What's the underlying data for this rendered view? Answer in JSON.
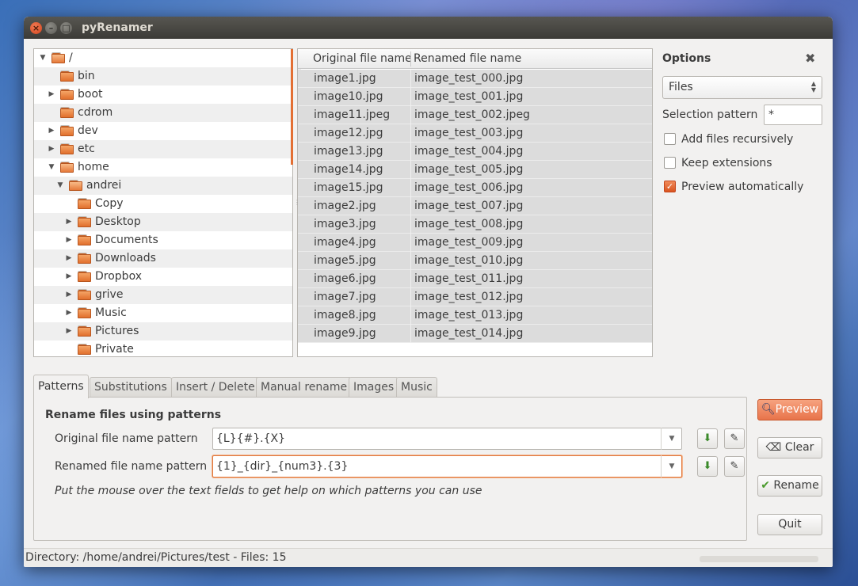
{
  "window": {
    "title": "pyRenamer"
  },
  "tree": {
    "items": [
      {
        "label": "/",
        "depth": 0,
        "expander": "open"
      },
      {
        "label": "bin",
        "depth": 1,
        "expander": "none"
      },
      {
        "label": "boot",
        "depth": 1,
        "expander": "closed"
      },
      {
        "label": "cdrom",
        "depth": 1,
        "expander": "none"
      },
      {
        "label": "dev",
        "depth": 1,
        "expander": "closed"
      },
      {
        "label": "etc",
        "depth": 1,
        "expander": "closed"
      },
      {
        "label": "home",
        "depth": 1,
        "expander": "open"
      },
      {
        "label": "andrei",
        "depth": 2,
        "expander": "open"
      },
      {
        "label": "Copy",
        "depth": 3,
        "expander": "none"
      },
      {
        "label": "Desktop",
        "depth": 3,
        "expander": "closed"
      },
      {
        "label": "Documents",
        "depth": 3,
        "expander": "closed"
      },
      {
        "label": "Downloads",
        "depth": 3,
        "expander": "closed"
      },
      {
        "label": "Dropbox",
        "depth": 3,
        "expander": "closed"
      },
      {
        "label": "grive",
        "depth": 3,
        "expander": "closed"
      },
      {
        "label": "Music",
        "depth": 3,
        "expander": "closed"
      },
      {
        "label": "Pictures",
        "depth": 3,
        "expander": "closed"
      },
      {
        "label": "Private",
        "depth": 3,
        "expander": "none"
      }
    ]
  },
  "filelist": {
    "columns": [
      "Original file name",
      "Renamed file name"
    ],
    "rows": [
      [
        "image1.jpg",
        "image_test_000.jpg"
      ],
      [
        "image10.jpg",
        "image_test_001.jpg"
      ],
      [
        "image11.jpeg",
        "image_test_002.jpeg"
      ],
      [
        "image12.jpg",
        "image_test_003.jpg"
      ],
      [
        "image13.jpg",
        "image_test_004.jpg"
      ],
      [
        "image14.jpg",
        "image_test_005.jpg"
      ],
      [
        "image15.jpg",
        "image_test_006.jpg"
      ],
      [
        "image2.jpg",
        "image_test_007.jpg"
      ],
      [
        "image3.jpg",
        "image_test_008.jpg"
      ],
      [
        "image4.jpg",
        "image_test_009.jpg"
      ],
      [
        "image5.jpg",
        "image_test_010.jpg"
      ],
      [
        "image6.jpg",
        "image_test_011.jpg"
      ],
      [
        "image7.jpg",
        "image_test_012.jpg"
      ],
      [
        "image8.jpg",
        "image_test_013.jpg"
      ],
      [
        "image9.jpg",
        "image_test_014.jpg"
      ]
    ]
  },
  "options": {
    "title": "Options",
    "close_icon": "close-icon",
    "type_select": "Files",
    "selection_label": "Selection pattern",
    "selection_value": "*",
    "checks": [
      {
        "label": "Add files recursively",
        "checked": false
      },
      {
        "label": "Keep extensions",
        "checked": false
      },
      {
        "label": "Preview automatically",
        "checked": true
      }
    ]
  },
  "tabs": [
    "Patterns",
    "Substitutions",
    "Insert / Delete",
    "Manual rename",
    "Images",
    "Music"
  ],
  "patterns": {
    "title": "Rename files using patterns",
    "original_label": "Original file name pattern",
    "original_value": "{L}{#}.{X}",
    "renamed_label": "Renamed file name pattern",
    "renamed_value": "{1}_{dir}_{num3}.{3}",
    "hint": "Put the mouse over the text fields to get help on which patterns you can use"
  },
  "buttons": {
    "preview": "Preview",
    "clear": "Clear",
    "rename": "Rename",
    "quit": "Quit"
  },
  "status": {
    "text": "Directory: /home/andrei/Pictures/test - Files: 15"
  },
  "colors": {
    "accent": "#e36f33",
    "titlebar": "#3c3b37",
    "close": "#d2451f"
  }
}
